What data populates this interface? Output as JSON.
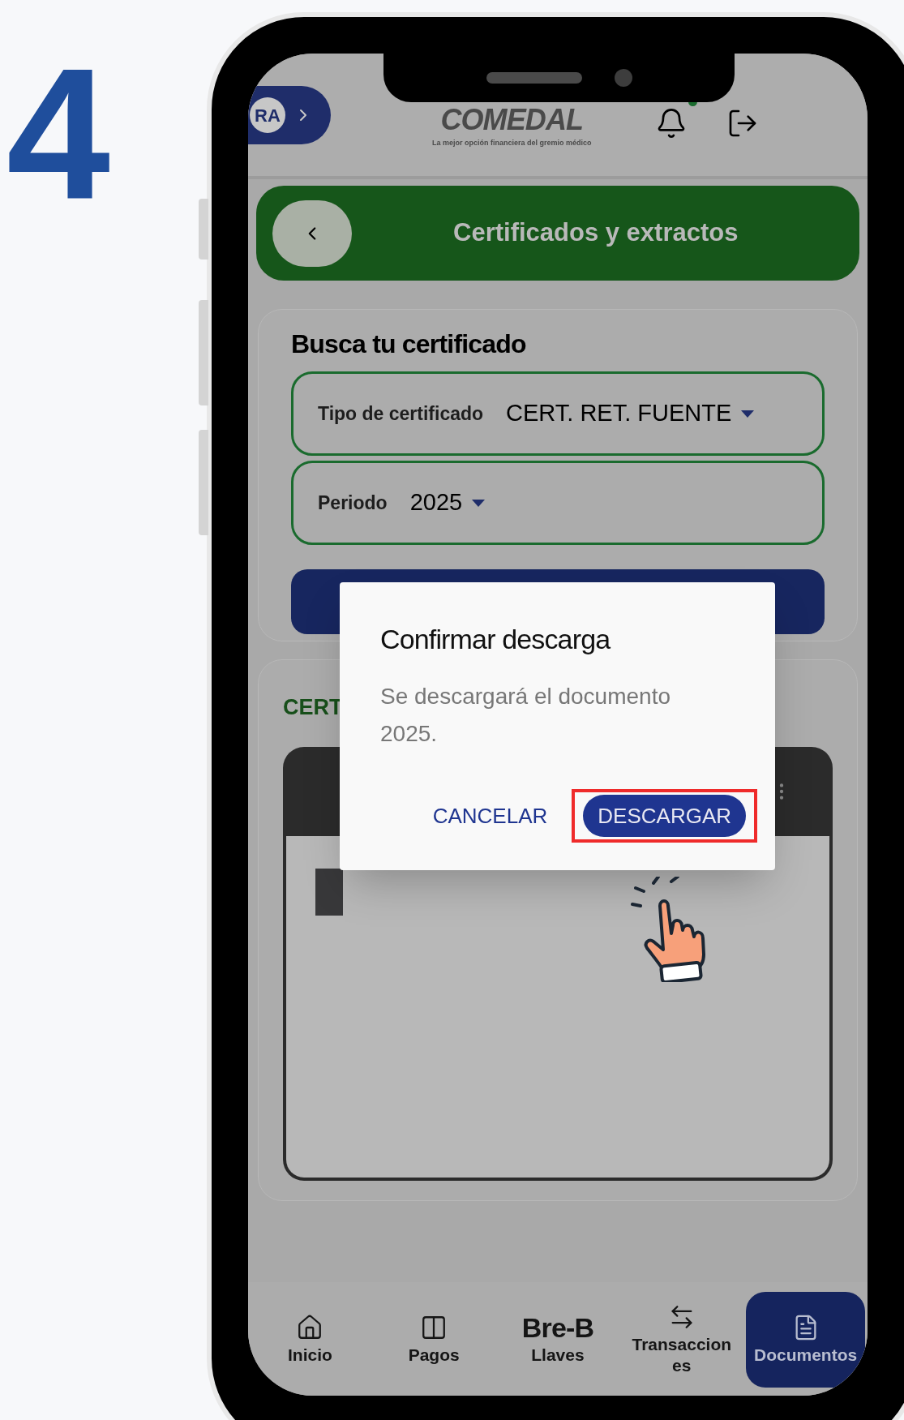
{
  "step_number": "4",
  "header": {
    "avatar": "RA",
    "logo": "COMEDAL",
    "tagline": "La mejor opción financiera del gremio médico",
    "has_notification": true
  },
  "title_bar": {
    "title": "Certificados y extractos"
  },
  "search_card": {
    "title": "Busca tu certificado",
    "fields": [
      {
        "label": "Tipo de certificado",
        "value": "CERT. RET. FUENTE"
      },
      {
        "label": "Periodo",
        "value": "2025"
      }
    ]
  },
  "results_card": {
    "title": "CERT"
  },
  "dialog": {
    "title": "Confirmar descarga",
    "message": "Se descargará el documento 2025.",
    "buttons": [
      {
        "label": "CANCELAR",
        "kind": "text",
        "highlighted": false
      },
      {
        "label": "DESCARGAR",
        "kind": "filled",
        "highlighted": true
      }
    ]
  },
  "bottom_nav": [
    {
      "label": "Inicio",
      "kind": "home",
      "selected": false
    },
    {
      "label": "Pagos",
      "kind": "card",
      "selected": false
    },
    {
      "label": "Llaves",
      "kind": "breb",
      "logo": "Bre-B",
      "selected": false
    },
    {
      "label": "Transacciones",
      "kind": "swap",
      "selected": false
    },
    {
      "label": "Documentos",
      "kind": "doc",
      "selected": true
    }
  ]
}
